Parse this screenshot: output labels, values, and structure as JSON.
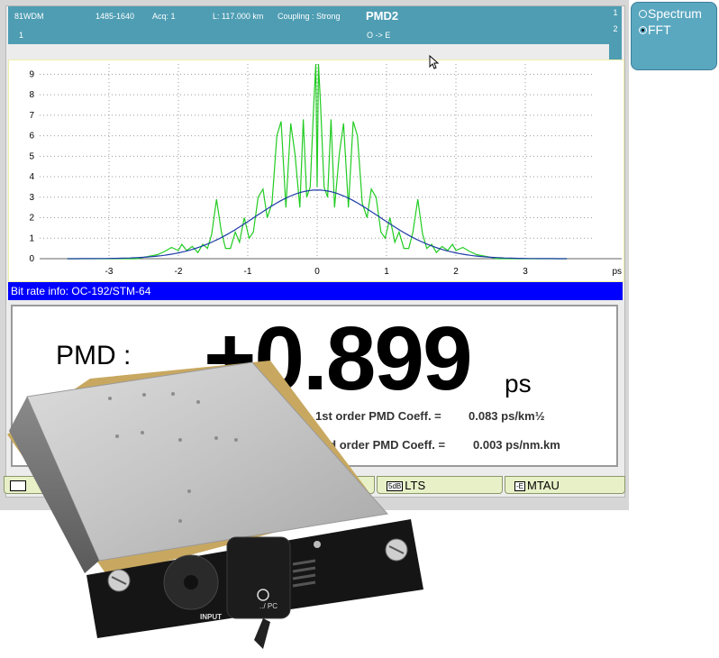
{
  "header": {
    "wdm": "81WDM",
    "channel": "1",
    "wavelength_range": "1485-1640",
    "acq": "Acq: 1",
    "length": "L: 117.000 km",
    "coupling": "Coupling : Strong",
    "title": "PMD2",
    "direction": "O -> E",
    "badge_1": "1",
    "badge_2": "2"
  },
  "options": {
    "spectrum_label": "Spectrum",
    "fft_label": "FFT",
    "selected": "FFT"
  },
  "chart_data": {
    "type": "line",
    "x_unit": "ps",
    "xlim": [
      -4,
      4
    ],
    "ylim": [
      0,
      9.5
    ],
    "x_ticks": [
      "-3",
      "-2",
      "-1",
      "0",
      "1",
      "2",
      "3"
    ],
    "y_ticks": [
      "0",
      "1",
      "2",
      "3",
      "4",
      "5",
      "6",
      "7",
      "8",
      "9"
    ],
    "grid": true,
    "series": [
      {
        "color": "#22cc22",
        "x": [
          -3.6,
          -2.6,
          -2.45,
          -2.3,
          -2.2,
          -2.1,
          -2.0,
          -1.95,
          -1.88,
          -1.8,
          -1.72,
          -1.65,
          -1.58,
          -1.52,
          -1.45,
          -1.38,
          -1.32,
          -1.25,
          -1.18,
          -1.12,
          -1.05,
          -0.98,
          -0.92,
          -0.85,
          -0.78,
          -0.72,
          -0.65,
          -0.58,
          -0.52,
          -0.45,
          -0.38,
          -0.32,
          -0.25,
          -0.2,
          -0.15,
          -0.1,
          -0.05,
          -0.02,
          0.0,
          0.02,
          0.05,
          0.1,
          0.15,
          0.2,
          0.25,
          0.32,
          0.38,
          0.45,
          0.52,
          0.58,
          0.65,
          0.72,
          0.78,
          0.85,
          0.92,
          0.98,
          1.05,
          1.12,
          1.18,
          1.25,
          1.32,
          1.38,
          1.45,
          1.52,
          1.58,
          1.65,
          1.72,
          1.8,
          1.88,
          1.95,
          2.0,
          2.1,
          2.2,
          2.3,
          2.45,
          2.6,
          3.6
        ],
        "y": [
          0.0,
          0.0,
          0.1,
          0.2,
          0.35,
          0.55,
          0.4,
          0.7,
          0.4,
          0.6,
          0.3,
          0.7,
          0.5,
          1.2,
          2.9,
          1.3,
          0.5,
          0.5,
          1.3,
          0.8,
          2.0,
          1.0,
          1.3,
          3.0,
          3.4,
          2.0,
          2.7,
          6.0,
          6.7,
          2.5,
          6.6,
          5.1,
          2.5,
          6.8,
          3.0,
          3.5,
          7.5,
          9.5,
          3.5,
          9.5,
          7.5,
          3.5,
          3.0,
          6.8,
          2.5,
          5.1,
          6.6,
          2.5,
          6.7,
          6.0,
          2.7,
          2.0,
          3.4,
          3.0,
          1.3,
          1.0,
          2.0,
          0.8,
          1.3,
          0.5,
          0.5,
          1.3,
          2.9,
          1.2,
          0.5,
          0.7,
          0.3,
          0.6,
          0.4,
          0.7,
          0.4,
          0.55,
          0.35,
          0.2,
          0.1,
          0.0,
          0.0
        ]
      },
      {
        "color": "#1e3ca8",
        "gaussian": {
          "amplitude": 3.35,
          "sigma": 0.9,
          "from": -3.6,
          "to": 3.6
        }
      }
    ]
  },
  "bitrate_info": "Bit rate info: OC-192/STM-64",
  "result": {
    "label": "PMD :",
    "value": "+0.899",
    "unit": "ps",
    "coef1_label": "1st order PMD Coeff. =",
    "coef1_value": "0.083 ps/km½",
    "coef2_label": "2nd order PMD Coeff. =",
    "coef2_value": "0.003 ps/nm.km"
  },
  "tabs": [
    {
      "label": ""
    },
    {
      "label": "LTS",
      "icon": "5dB"
    },
    {
      "label": "MTAU",
      "icon": "-E"
    }
  ],
  "module": {
    "input_label": "INPUT",
    "connector_label": "../ PC"
  }
}
